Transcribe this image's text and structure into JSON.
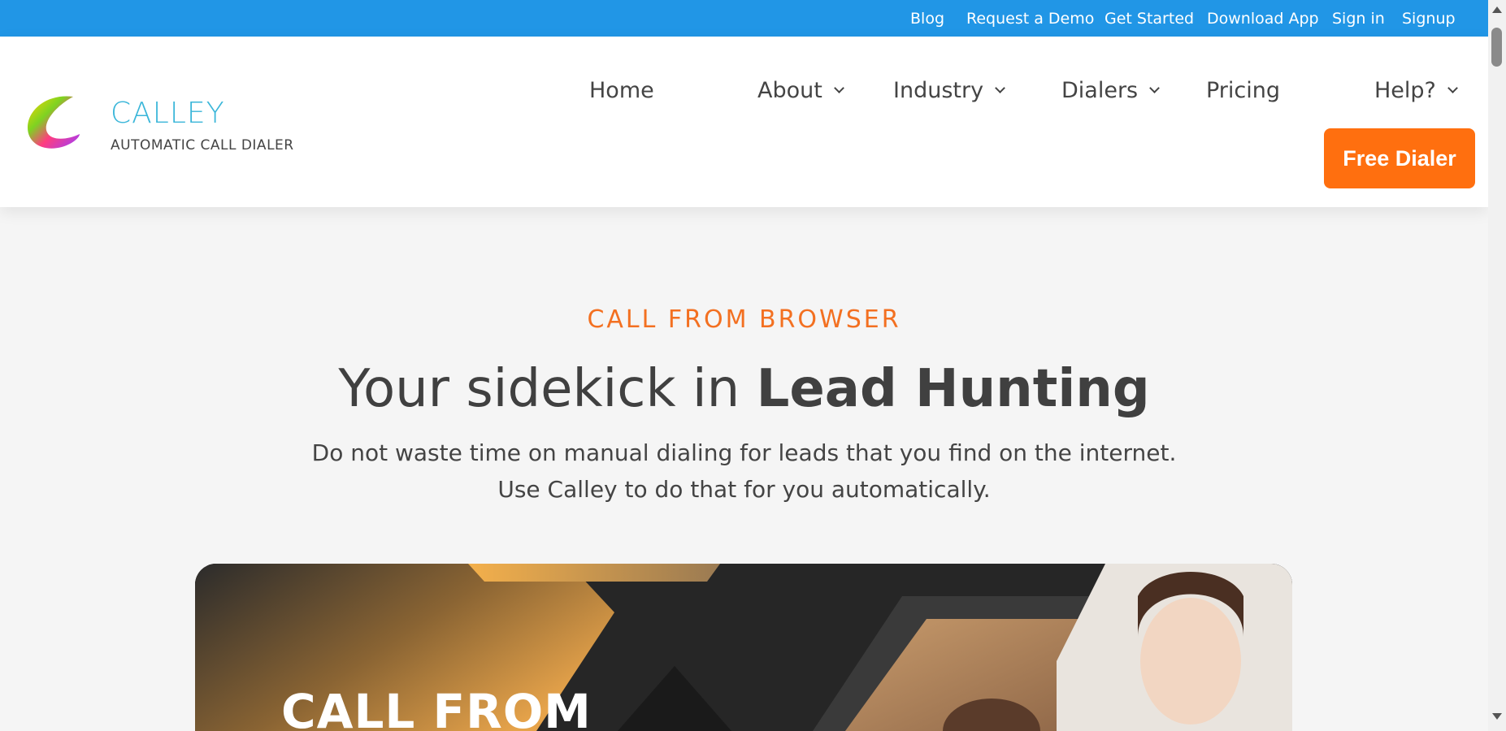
{
  "topbar": {
    "links": [
      "Blog",
      "Request a Demo",
      "Get Started",
      "Download App",
      "Sign in",
      "Signup"
    ]
  },
  "logo": {
    "title": "CALLEY",
    "subtitle": "AUTOMATIC CALL DIALER"
  },
  "nav": {
    "home": "Home",
    "about": "About",
    "industry": "Industry",
    "dialers": "Dialers",
    "pricing": "Pricing",
    "help": "Help?"
  },
  "cta": {
    "label": "Free Dialer"
  },
  "hero": {
    "eyebrow": "CALL FROM BROWSER",
    "headline_regular": "Your sidekick in ",
    "headline_bold": "Lead Hunting",
    "desc_line1": "Do not waste time on manual dialing for leads that you find on the internet.",
    "desc_line2": "Use Calley to do that for you automatically."
  },
  "banner": {
    "title": "CALL FROM"
  },
  "colors": {
    "topbar": "#2196e6",
    "accent": "#ff6f0f",
    "eyebrow": "#f37021",
    "logo": "#3ab6d9"
  }
}
